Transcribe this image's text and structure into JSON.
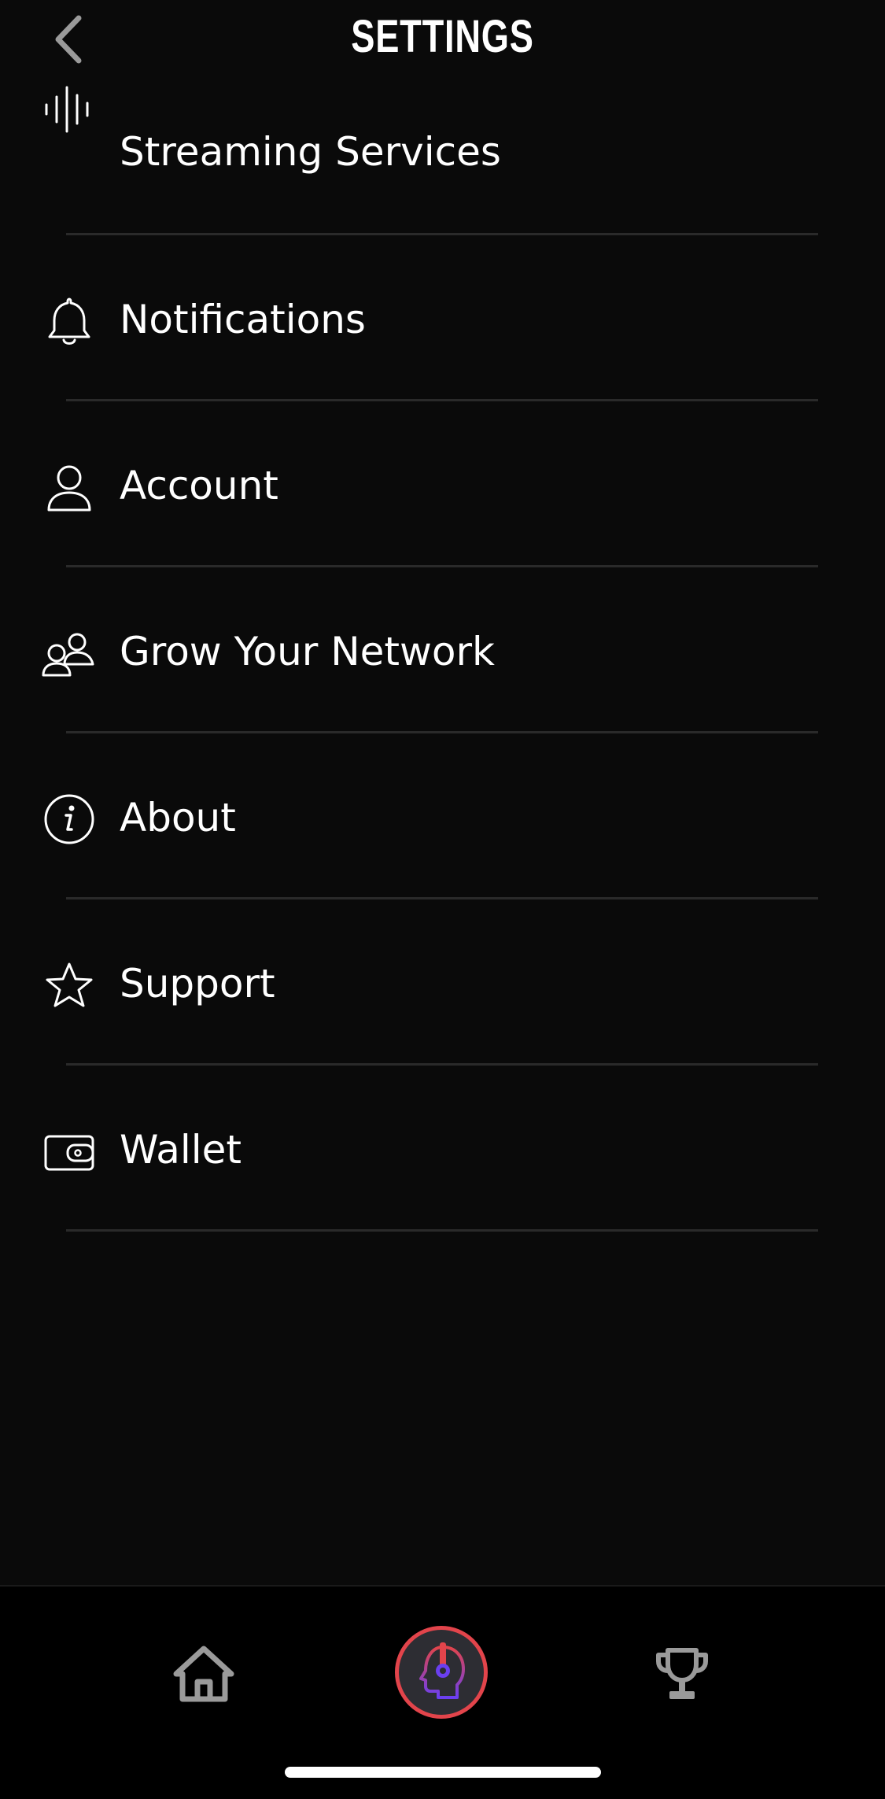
{
  "header": {
    "title": "SETTINGS",
    "back_icon": "chevron-left-icon"
  },
  "menu": {
    "items": [
      {
        "label": "Streaming Services",
        "icon": "sound-wave-icon"
      },
      {
        "label": "Notifications",
        "icon": "bell-icon"
      },
      {
        "label": "Account",
        "icon": "person-icon"
      },
      {
        "label": "Grow Your Network",
        "icon": "people-icon"
      },
      {
        "label": "About",
        "icon": "info-icon"
      },
      {
        "label": "Support",
        "icon": "star-icon"
      },
      {
        "label": "Wallet",
        "icon": "wallet-icon"
      }
    ]
  },
  "bottom_nav": {
    "items": [
      {
        "name": "home",
        "icon": "home-icon"
      },
      {
        "name": "profile",
        "icon": "head-headphones-icon"
      },
      {
        "name": "trophy",
        "icon": "trophy-icon"
      }
    ]
  },
  "colors": {
    "background": "#0a0a0a",
    "divider": "#2a2a2a",
    "accent_ring": "#e2444b",
    "nav_icon": "#9a9a9a"
  }
}
